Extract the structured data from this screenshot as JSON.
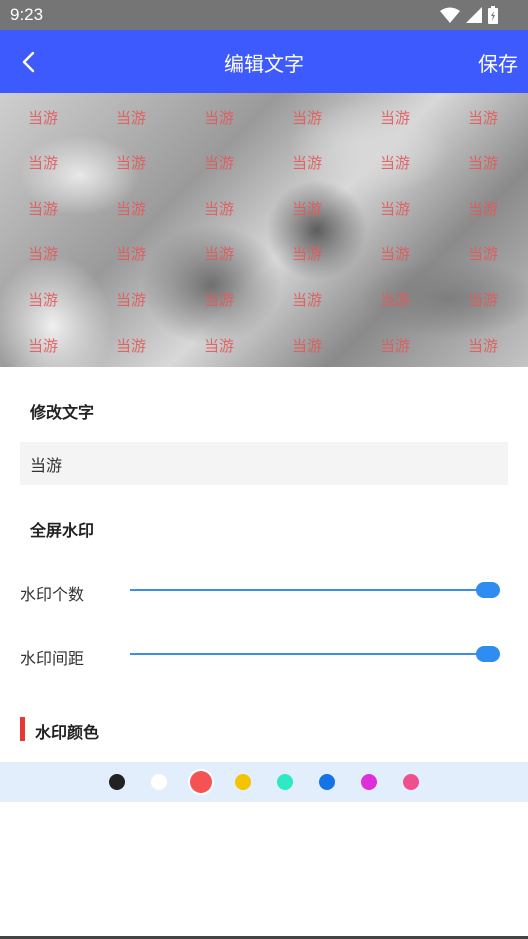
{
  "status_bar": {
    "time": "9:23"
  },
  "app_bar": {
    "title": "编辑文字",
    "save_label": "保存"
  },
  "preview": {
    "watermark_text": "当游",
    "rows": 6,
    "cols": 6
  },
  "edit_text": {
    "heading": "修改文字",
    "value": "当游"
  },
  "fullscreen": {
    "heading": "全屏水印"
  },
  "sliders": [
    {
      "label": "水印个数",
      "value_fraction": 1.0
    },
    {
      "label": "水印间距",
      "value_fraction": 1.0
    }
  ],
  "color_section": {
    "heading": "水印颜色",
    "selected_index": 2,
    "colors": [
      "#222222",
      "#ffffff",
      "#f55252",
      "#f5c400",
      "#2ee8c6",
      "#1473e6",
      "#dd30dd",
      "#f04f8e"
    ]
  },
  "icons": {
    "back": "chevron-left-icon",
    "wifi": "wifi-icon",
    "signal": "signal-icon",
    "battery": "battery-icon"
  }
}
